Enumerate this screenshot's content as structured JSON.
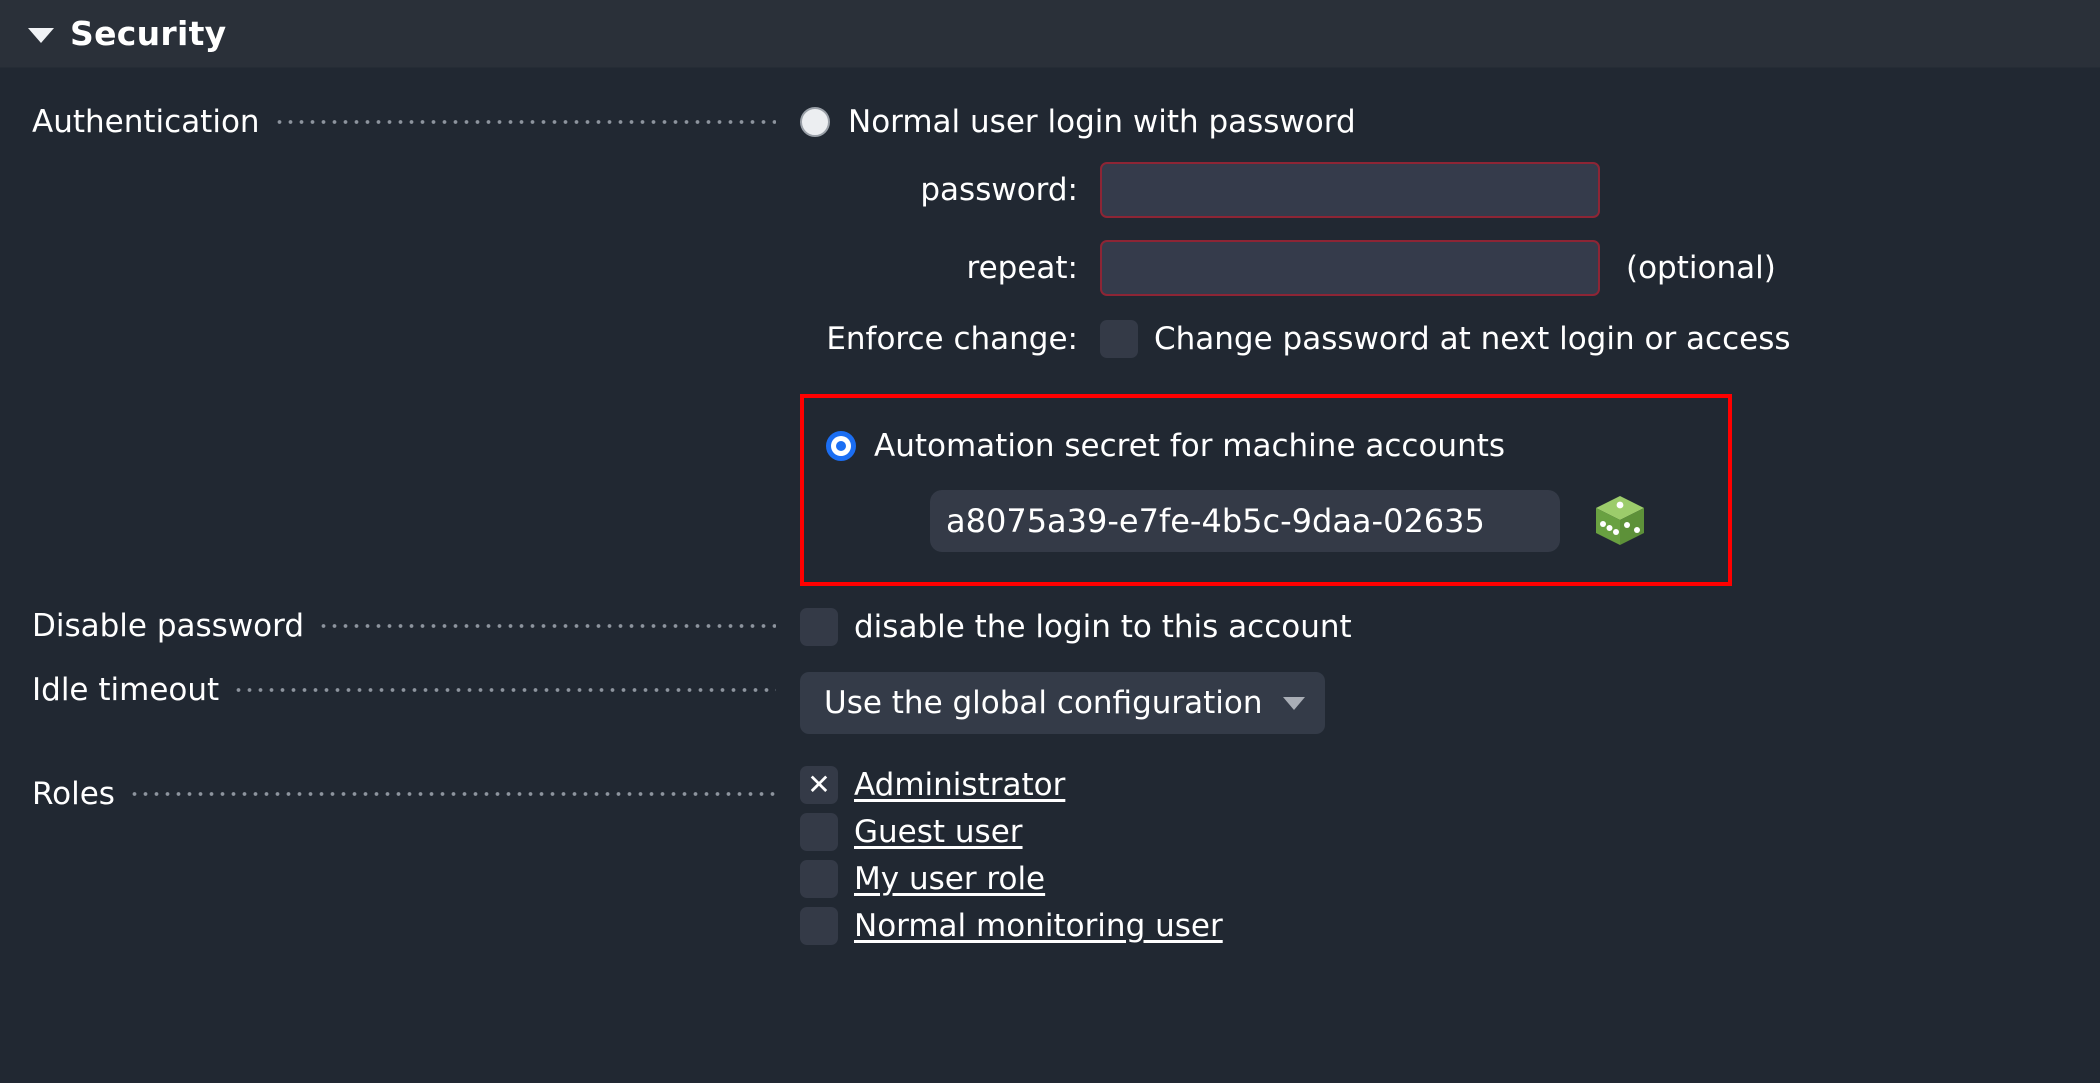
{
  "section": {
    "title": "Security",
    "caret_icon": "caret-down-icon",
    "expanded": true
  },
  "colors": {
    "page_background": "#212832",
    "header_background": "#2a3039",
    "highlight_border": "#ff0000",
    "radio_selected": "#1b6ef3",
    "input_error_border": "#8d2535",
    "input_background": "#343a47",
    "dice_green": "#78b153"
  },
  "authentication": {
    "label": "Authentication",
    "options": [
      {
        "label": "Normal user login with password",
        "selected": false,
        "fields": [
          {
            "label": "password:",
            "value": "",
            "placeholder": ""
          },
          {
            "label": "repeat:",
            "value": "",
            "placeholder": "",
            "suffix": "(optional)"
          }
        ],
        "enforce": {
          "label": "Enforce change:",
          "checked": false,
          "checkbox_text": "Change password at next login or access"
        }
      },
      {
        "label": "Automation secret for machine accounts",
        "selected": true,
        "highlighted": true,
        "secret": {
          "value": "a8075a39-e7fe-4b5c-9daa-02635",
          "regenerate_icon": "dice-icon"
        }
      }
    ]
  },
  "disable_password": {
    "label": "Disable password",
    "checked": false,
    "checkbox_text": "disable the login to this account"
  },
  "idle_timeout": {
    "label": "Idle timeout",
    "selected_option": "Use the global configuration",
    "caret_icon": "chevron-down-icon"
  },
  "roles": {
    "label": "Roles",
    "items": [
      {
        "label": "Administrator",
        "checked": true,
        "mark": "✕"
      },
      {
        "label": "Guest user",
        "checked": false,
        "mark": ""
      },
      {
        "label": "My user role",
        "checked": false,
        "mark": ""
      },
      {
        "label": "Normal monitoring user",
        "checked": false,
        "mark": ""
      }
    ]
  }
}
